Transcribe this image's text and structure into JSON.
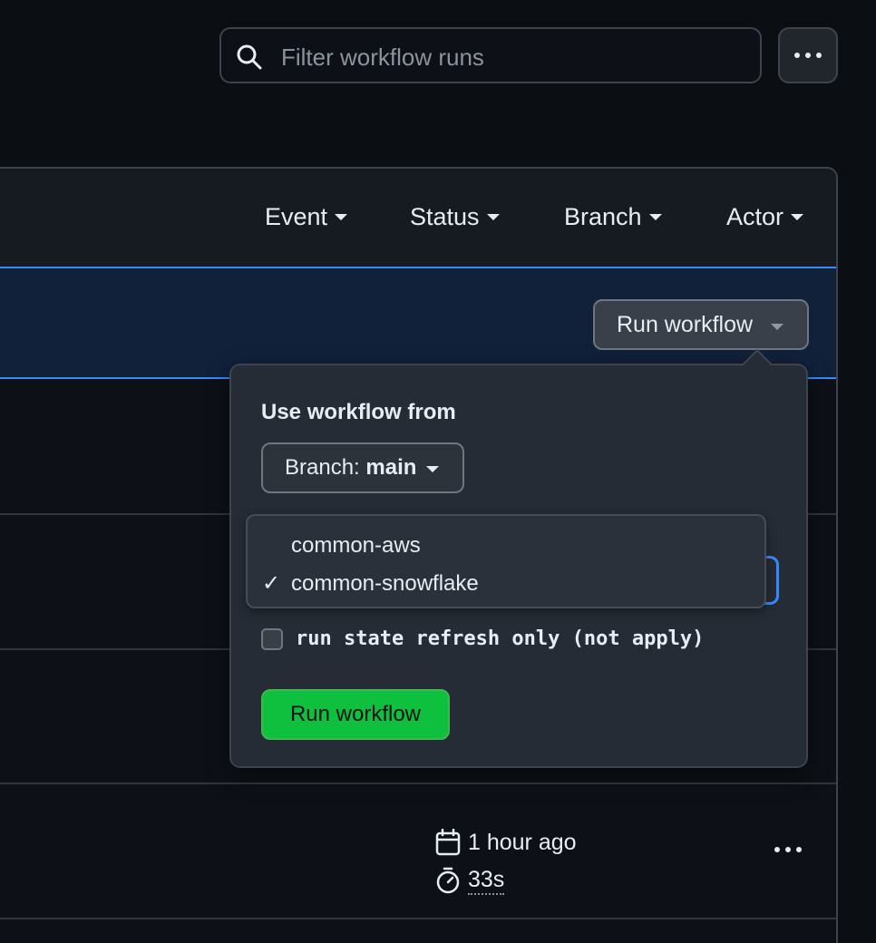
{
  "search": {
    "placeholder": "Filter workflow runs"
  },
  "header_filters": [
    {
      "label": "Event"
    },
    {
      "label": "Status"
    },
    {
      "label": "Branch"
    },
    {
      "label": "Actor"
    }
  ],
  "banner": {
    "run_workflow_label": "Run workflow"
  },
  "popover": {
    "title": "Use workflow from",
    "branch_button": {
      "prefix": "Branch: ",
      "value": "main"
    },
    "branches": [
      {
        "label": "common-aws",
        "selected": false
      },
      {
        "label": "common-snowflake",
        "selected": true
      }
    ],
    "check_glyph": "✓",
    "checkbox": {
      "label": "run state refresh only (not apply)",
      "checked": false
    },
    "submit_label": "Run workflow"
  },
  "run_row": {
    "time_ago": "1 hour ago",
    "duration": "33s"
  },
  "colors": {
    "accent_blue": "#388bfd",
    "success_green": "#0fbf3e"
  }
}
